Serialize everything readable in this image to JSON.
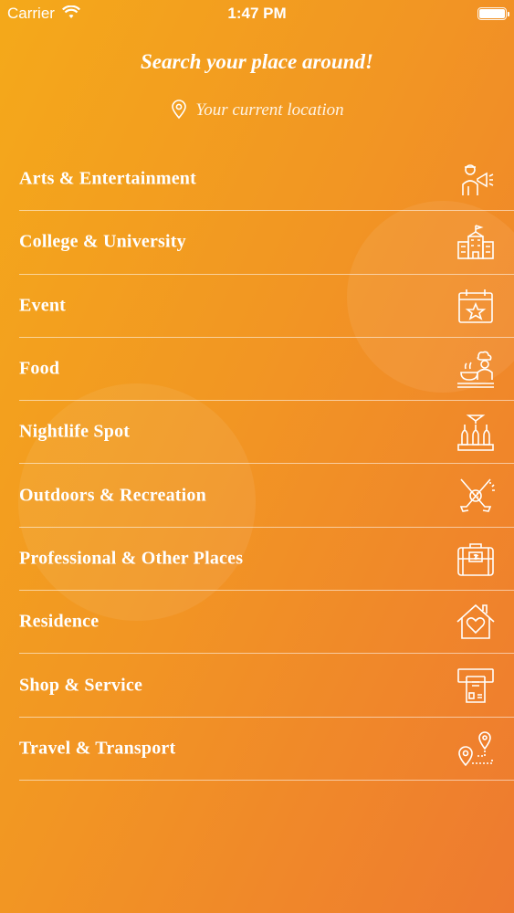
{
  "status_bar": {
    "carrier": "Carrier",
    "time": "1:47 PM"
  },
  "header": {
    "title": "Search your place around!",
    "location_text": "Your current location"
  },
  "categories": [
    {
      "label": "Arts & Entertainment",
      "icon": "performer-megaphone-icon"
    },
    {
      "label": "College & University",
      "icon": "university-building-icon"
    },
    {
      "label": "Event",
      "icon": "calendar-star-icon"
    },
    {
      "label": "Food",
      "icon": "chef-cooking-icon"
    },
    {
      "label": "Nightlife Spot",
      "icon": "bottles-icon"
    },
    {
      "label": "Outdoors & Recreation",
      "icon": "golf-clubs-icon"
    },
    {
      "label": "Professional & Other Places",
      "icon": "briefcase-icon"
    },
    {
      "label": "Residence",
      "icon": "house-heart-icon"
    },
    {
      "label": "Shop & Service",
      "icon": "card-payment-icon"
    },
    {
      "label": "Travel & Transport",
      "icon": "route-pin-icon"
    }
  ]
}
